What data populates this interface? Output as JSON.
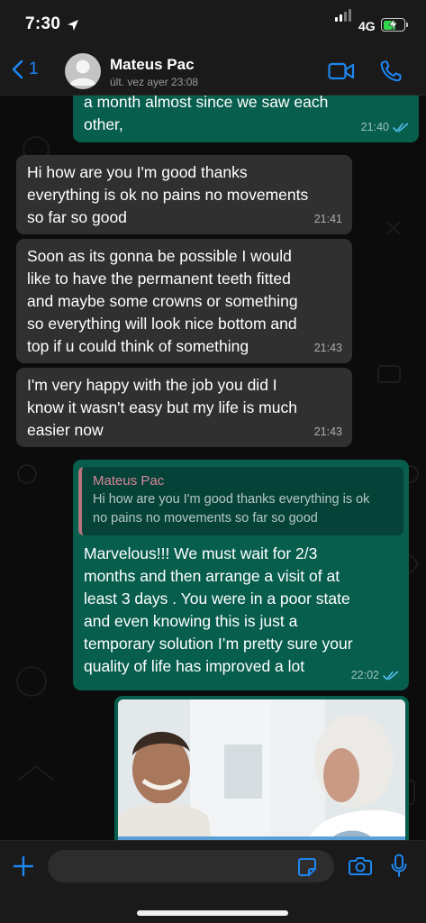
{
  "status_bar": {
    "time": "7:30",
    "network": "4G",
    "battery_level": 0.6,
    "icons": [
      "location-arrow-icon",
      "signal-bars-icon",
      "battery-charging-icon"
    ]
  },
  "header": {
    "back_count": "1",
    "contact_name": "Mateus Pac",
    "contact_status": "últ. vez ayer 23:08",
    "icons": [
      "chevron-left-icon",
      "avatar-placeholder-icon",
      "video-call-icon",
      "phone-call-icon"
    ]
  },
  "messages": [
    {
      "direction": "out",
      "text": "a month almost since we saw each\nother,",
      "time": "21:40",
      "read": true
    },
    {
      "direction": "in",
      "text": "Hi how are you I'm good thanks\neverything is ok no pains no movements\nso far so good",
      "time": "21:41"
    },
    {
      "direction": "in",
      "text": "Soon as its gonna be possible I would\nlike to have the permanent teeth fitted\nand maybe some crowns or something\nso everything will look nice bottom and\ntop if u could think of something",
      "time": "21:43"
    },
    {
      "direction": "in",
      "text": "I'm very happy with the job you did I\nknow it wasn't easy but my life is much\neasier now",
      "time": "21:43"
    },
    {
      "direction": "out",
      "reply_to": {
        "name": "Mateus Pac",
        "text": "Hi how are you I'm good thanks everything is ok\nno pains no movements so far so good"
      },
      "text": "Marvelous!!! We must wait for 2/3\nmonths and then arrange a visit of at\nleast 3 days . You were in a poor state\nand even knowing this is just a\ntemporary solution I’m pretty sure your\nquality of life has improved a lot",
      "time": "22:02",
      "read": true
    },
    {
      "direction": "out",
      "type": "image",
      "image": "photo-smiling-patient-with-doctor"
    }
  ],
  "input_bar": {
    "icons": [
      "plus-icon",
      "sticker-icon",
      "camera-icon",
      "microphone-icon"
    ]
  },
  "colors": {
    "accent": "#1e86f0",
    "outgoing_bubble": "#075e4d",
    "incoming_bubble": "#303030",
    "read_ticks": "#53bdeb",
    "reply_name": "#d9859b"
  }
}
